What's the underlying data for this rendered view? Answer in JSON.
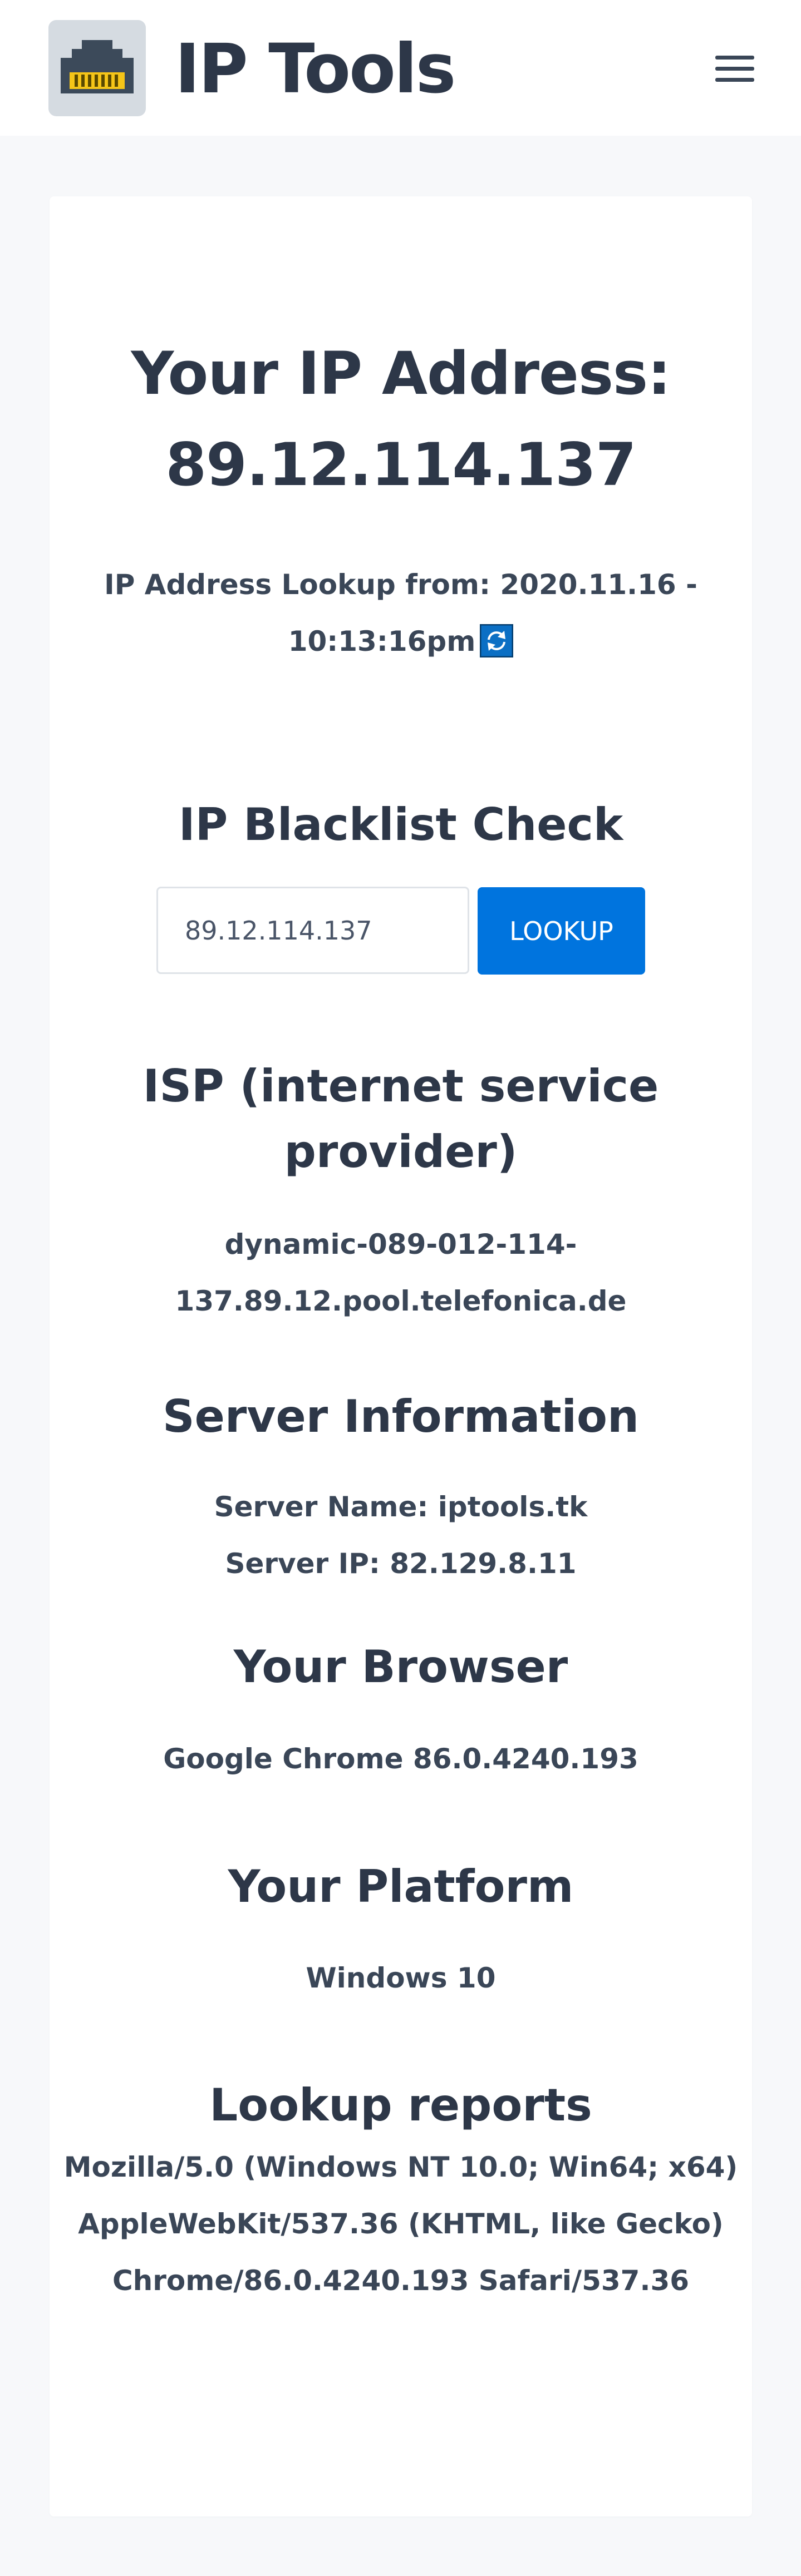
{
  "header": {
    "brand": "IP Tools",
    "logo_icon": "ethernet-port-icon",
    "menu_icon": "hamburger-menu-icon"
  },
  "ip_section": {
    "title_prefix": "Your IP Address:",
    "ip": "89.12.114.137",
    "lookup_line1": "IP Address Lookup from: 2020.11.16 -",
    "lookup_line2": "10:13:16pm",
    "refresh_icon": "refresh-icon"
  },
  "blacklist": {
    "title": "IP Blacklist Check",
    "input_value": "89.12.114.137",
    "button_label": "LOOKUP"
  },
  "isp": {
    "title_line1": "ISP (internet service",
    "title_line2": "provider)",
    "host_line1": "dynamic-089-012-114-",
    "host_line2": "137.89.12.pool.telefonica.de"
  },
  "server": {
    "title": "Server Information",
    "name": "Server Name: iptools.tk",
    "ip": "Server IP: 82.129.8.11"
  },
  "browser": {
    "title": "Your Browser",
    "value": "Google Chrome 86.0.4240.193"
  },
  "platform": {
    "title": "Your Platform",
    "value": "Windows 10"
  },
  "reports": {
    "title": "Lookup reports",
    "ua_line1": "Mozilla/5.0 (Windows NT 10.0; Win64; x64)",
    "ua_line2": "AppleWebKit/537.36 (KHTML, like Gecko)",
    "ua_line3": "Chrome/86.0.4240.193 Safari/537.36"
  },
  "colors": {
    "accent": "#0074de",
    "text": "#2d3748",
    "page_bg": "#f7f8fa",
    "logo_yellow": "#f5c518"
  }
}
